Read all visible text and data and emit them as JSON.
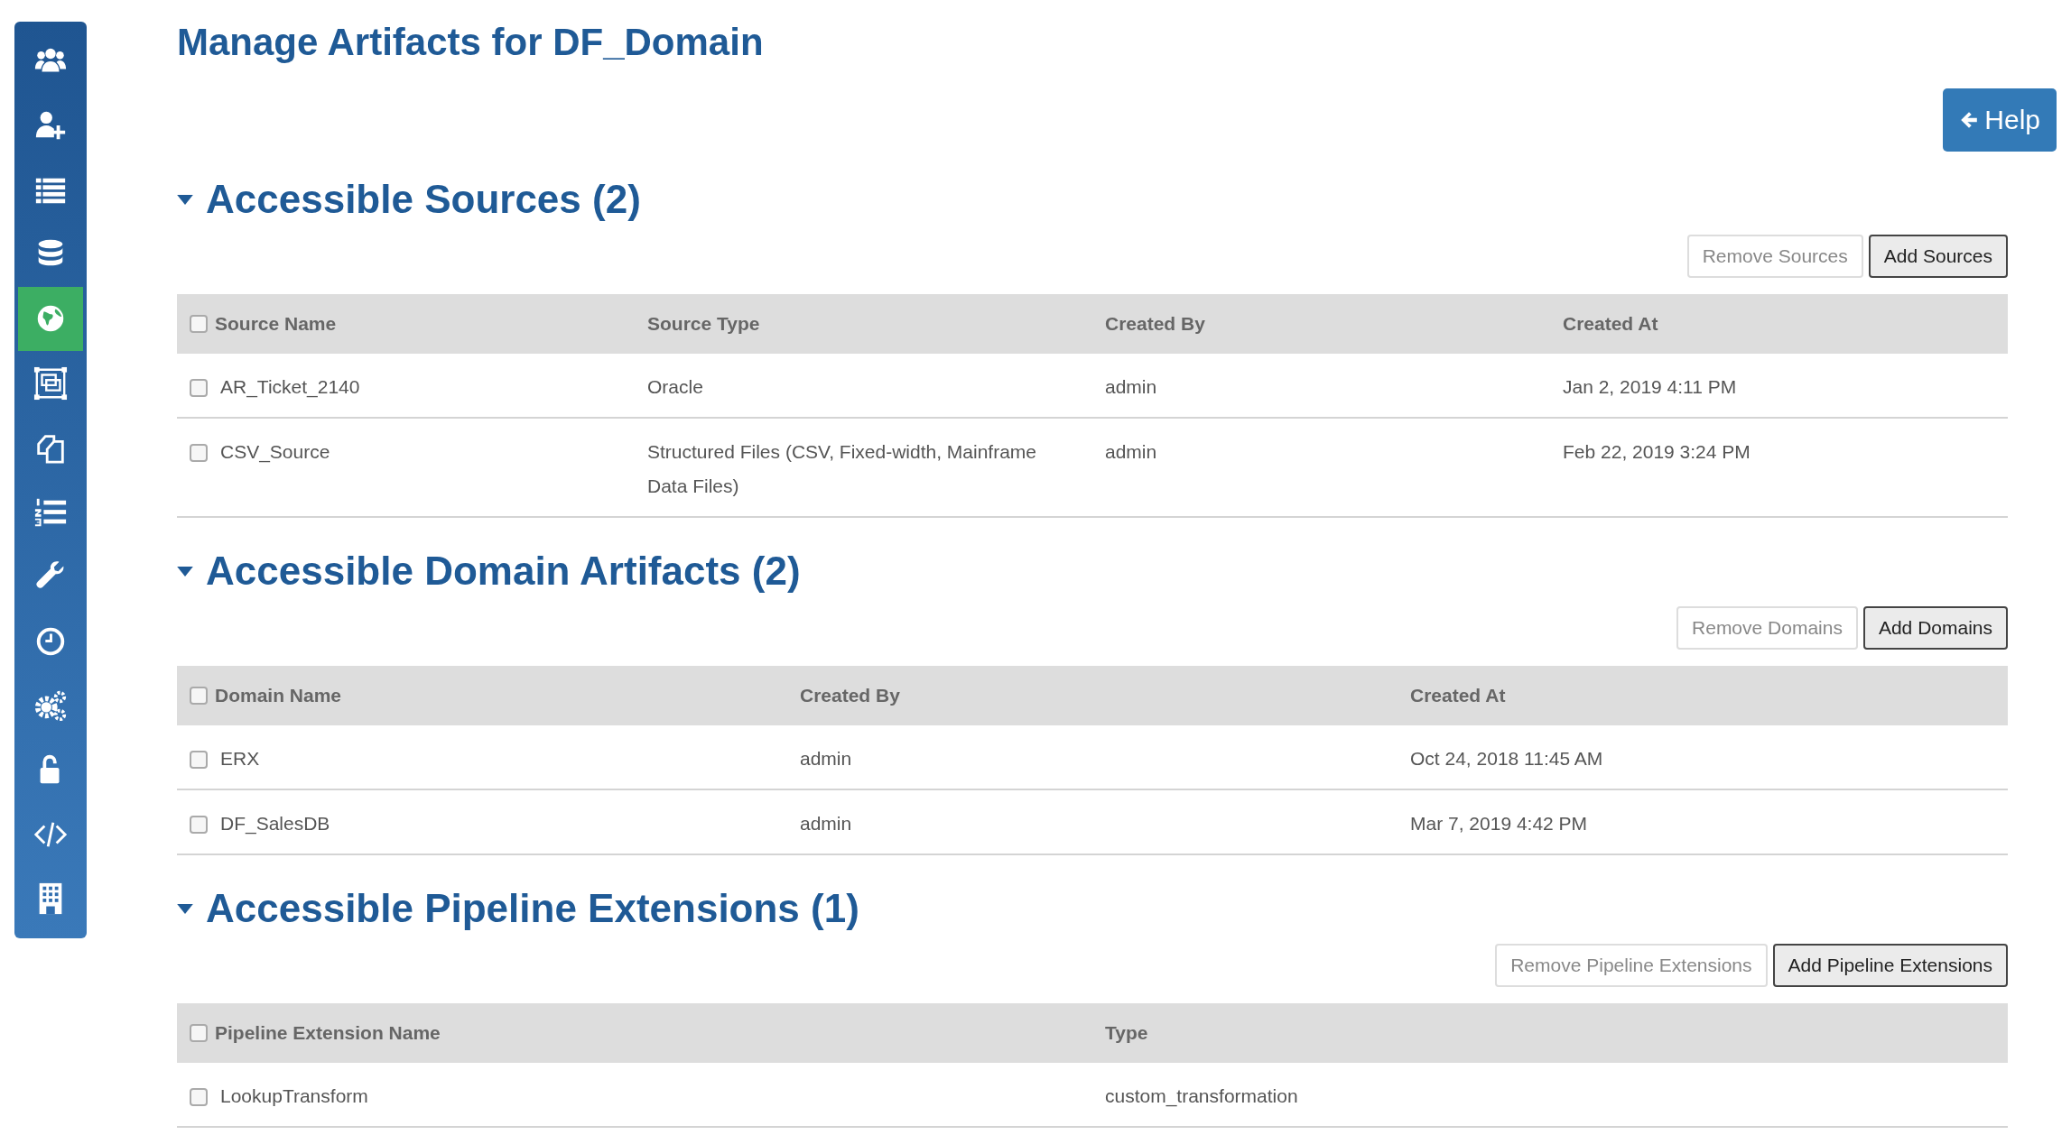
{
  "sidebar": {
    "items": [
      {
        "selected": false
      },
      {
        "selected": false
      },
      {
        "selected": false
      },
      {
        "selected": false
      },
      {
        "selected": true
      },
      {
        "selected": false
      },
      {
        "selected": false
      },
      {
        "selected": false
      },
      {
        "selected": false
      },
      {
        "selected": false
      },
      {
        "selected": false
      },
      {
        "selected": false
      },
      {
        "selected": false
      },
      {
        "selected": false
      }
    ]
  },
  "page_title": "Manage Artifacts for DF_Domain",
  "help_button": {
    "label": "Help"
  },
  "sections": [
    {
      "title": "Accessible Sources (2)",
      "expanded": true,
      "buttons": [
        {
          "label": "Remove Sources",
          "disabled": true
        },
        {
          "label": "Add Sources",
          "disabled": false
        }
      ],
      "header_checked": false,
      "columns": [
        "Source Name",
        "Source Type",
        "Created By",
        "Created At"
      ],
      "rows": [
        {
          "checked": false,
          "cells": [
            "AR_Ticket_2140",
            "Oracle",
            "admin",
            "Jan 2, 2019 4:11 PM"
          ]
        },
        {
          "checked": false,
          "cells": [
            "CSV_Source",
            "Structured Files (CSV, Fixed-width, Mainframe Data Files)",
            "admin",
            "Feb 22, 2019 3:24 PM"
          ]
        }
      ]
    },
    {
      "title": "Accessible Domain Artifacts (2)",
      "expanded": true,
      "buttons": [
        {
          "label": "Remove Domains",
          "disabled": true
        },
        {
          "label": "Add Domains",
          "disabled": false
        }
      ],
      "header_checked": false,
      "columns": [
        "Domain Name",
        "Created By",
        "Created At"
      ],
      "rows": [
        {
          "checked": false,
          "cells": [
            "ERX",
            "admin",
            "Oct 24, 2018 11:45 AM"
          ]
        },
        {
          "checked": false,
          "cells": [
            "DF_SalesDB",
            "admin",
            "Mar 7, 2019 4:42 PM"
          ]
        }
      ]
    },
    {
      "title": "Accessible Pipeline Extensions (1)",
      "expanded": true,
      "buttons": [
        {
          "label": "Remove Pipeline Extensions",
          "disabled": true
        },
        {
          "label": "Add Pipeline Extensions",
          "disabled": false
        }
      ],
      "header_checked": false,
      "columns": [
        "Pipeline Extension Name",
        "Type"
      ],
      "rows": [
        {
          "checked": false,
          "cells": [
            "LookupTransform",
            "custom_transformation"
          ]
        }
      ]
    }
  ]
}
